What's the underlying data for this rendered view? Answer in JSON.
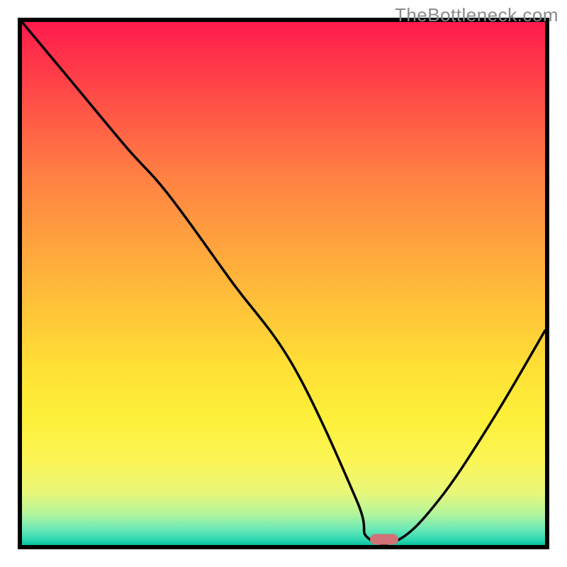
{
  "watermark": "TheBottleneck.com",
  "colors": {
    "frame": "#000000",
    "curve": "#000000",
    "marker": "#d27276"
  },
  "chart_data": {
    "type": "line",
    "title": "",
    "xlabel": "",
    "ylabel": "",
    "xlim": [
      0,
      100
    ],
    "ylim": [
      0,
      100
    ],
    "grid": false,
    "legend": false,
    "curve": {
      "x": [
        0,
        10,
        20,
        28,
        40,
        52,
        64,
        66,
        72,
        80,
        90,
        100
      ],
      "y": [
        100,
        88,
        76,
        67,
        50.5,
        34,
        8.5,
        1.5,
        1,
        9,
        24,
        41
      ]
    },
    "marker": {
      "x": 69.2,
      "y": 1.1
    },
    "gradient_stops": [
      {
        "pct": 0,
        "color": "#ff1a4d"
      },
      {
        "pct": 18,
        "color": "#ff5946"
      },
      {
        "pct": 42,
        "color": "#ffa23e"
      },
      {
        "pct": 66,
        "color": "#ffe035"
      },
      {
        "pct": 84,
        "color": "#fbf556"
      },
      {
        "pct": 94,
        "color": "#b4f59b"
      },
      {
        "pct": 100,
        "color": "#08c29c"
      }
    ]
  }
}
